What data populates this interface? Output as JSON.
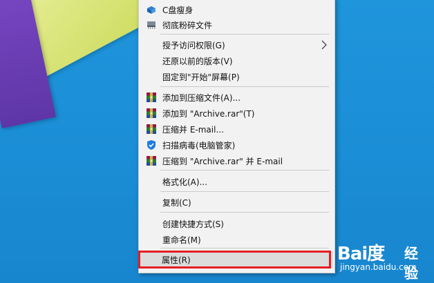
{
  "colors": {
    "desktop_bg": "#1b8fd6",
    "menu_bg": "#f2f2f2",
    "highlight_border": "#e51c23"
  },
  "menu": {
    "items": [
      {
        "label": "C盘瘦身",
        "icon": "disk-clean-icon"
      },
      {
        "label": "彻底粉碎文件",
        "icon": "shredder-icon"
      },
      {
        "label": "授予访问权限(G)",
        "icon": "",
        "submenu": true
      },
      {
        "label": "还原以前的版本(V)",
        "icon": ""
      },
      {
        "label": "固定到\"开始\"屏幕(P)",
        "icon": ""
      },
      {
        "label": "添加到压缩文件(A)...",
        "icon": "winrar-icon"
      },
      {
        "label": "添加到 \"Archive.rar\"(T)",
        "icon": "winrar-icon"
      },
      {
        "label": "压缩并 E-mail...",
        "icon": "winrar-icon"
      },
      {
        "label": "扫描病毒(电脑管家)",
        "icon": "shield-icon"
      },
      {
        "label": "压缩到 \"Archive.rar\" 并 E-mail",
        "icon": "winrar-icon"
      },
      {
        "label": "格式化(A)...",
        "icon": ""
      },
      {
        "label": "复制(C)",
        "icon": ""
      },
      {
        "label": "创建快捷方式(S)",
        "icon": ""
      },
      {
        "label": "重命名(M)",
        "icon": ""
      },
      {
        "label": "属性(R)",
        "icon": ""
      }
    ]
  },
  "watermark": {
    "logo": "Bai度",
    "suffix": "经验",
    "url": "jingyan.baidu.com"
  }
}
